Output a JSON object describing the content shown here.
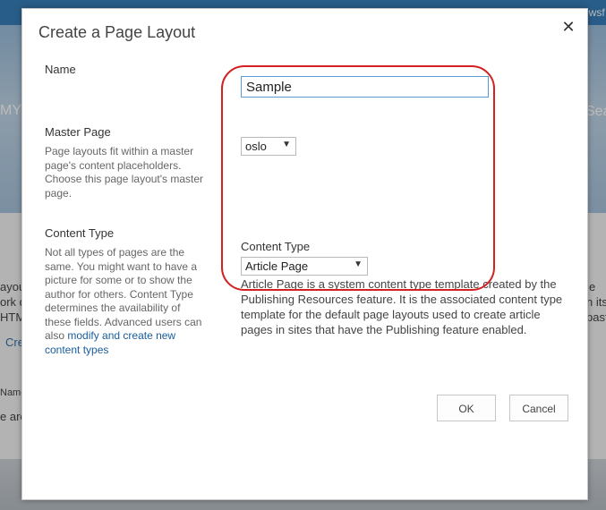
{
  "background": {
    "top_right": "ewsf",
    "banner_left": "MY F",
    "banner_right": "Seas",
    "left_fragments": [
      "ayou",
      "ork d",
      "HTM",
      "Cre",
      "Name",
      "e are"
    ],
    "right_fragments": [
      "e",
      "n its",
      "past"
    ]
  },
  "dialog": {
    "title": "Create a Page Layout",
    "close_glyph": "✕",
    "name": {
      "label": "Name",
      "value": "Sample"
    },
    "master_page": {
      "label": "Master Page",
      "description": "Page layouts fit within a master page's content placeholders. Choose this page layout's master page.",
      "selected": "oslo"
    },
    "content_type": {
      "label": "Content Type",
      "description": "Not all types of pages are the same. You might want to have a picture for some or to show the author for others. Content Type determines the availability of these fields. Advanced users can also",
      "link": "modify and create new content types",
      "field_label": "Content Type",
      "selected": "Article Page",
      "selected_description": "Article Page is a system content type template created by the Publishing Resources feature. It is the associated content type template for the default page layouts used to create article pages in sites that have the Publishing feature enabled."
    },
    "buttons": {
      "ok": "OK",
      "cancel": "Cancel"
    }
  },
  "icons": {
    "dropdown_arrow": "▼"
  },
  "colors": {
    "annotation": "#d32020",
    "link": "#1a5ea0",
    "focus_border": "#5b9bd5"
  }
}
